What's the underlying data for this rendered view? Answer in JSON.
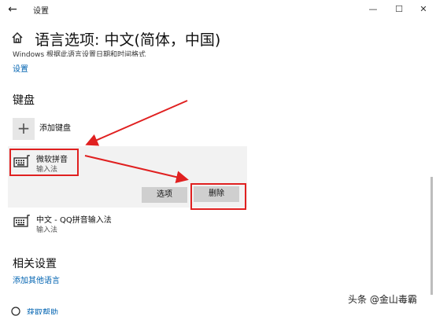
{
  "window": {
    "back_glyph": "←",
    "title": "设置",
    "min_glyph": "—",
    "max_glyph": "☐",
    "close_glyph": "✕"
  },
  "header": {
    "title": "语言选项: 中文(简体，中国)",
    "clipped_text": "Windows 根据此语言设置日期和时间格式",
    "settings_link": "设置"
  },
  "keyboard_section": {
    "heading": "键盘",
    "add_glyph": "+",
    "add_label": "添加键盘",
    "items": [
      {
        "name": "微软拼音",
        "type": "输入法"
      },
      {
        "name": "中文 - QQ拼音输入法",
        "type": "输入法"
      }
    ],
    "options_label": "选项",
    "remove_label": "删除"
  },
  "related_section": {
    "heading": "相关设置",
    "link": "添加其他语言"
  },
  "help": {
    "label": "获取帮助"
  },
  "watermark": "头条 @金山毒霸",
  "colors": {
    "accent": "#0063b1",
    "highlight": "#e02020",
    "panel": "#f2f2f2",
    "button": "#cfcfcf"
  }
}
